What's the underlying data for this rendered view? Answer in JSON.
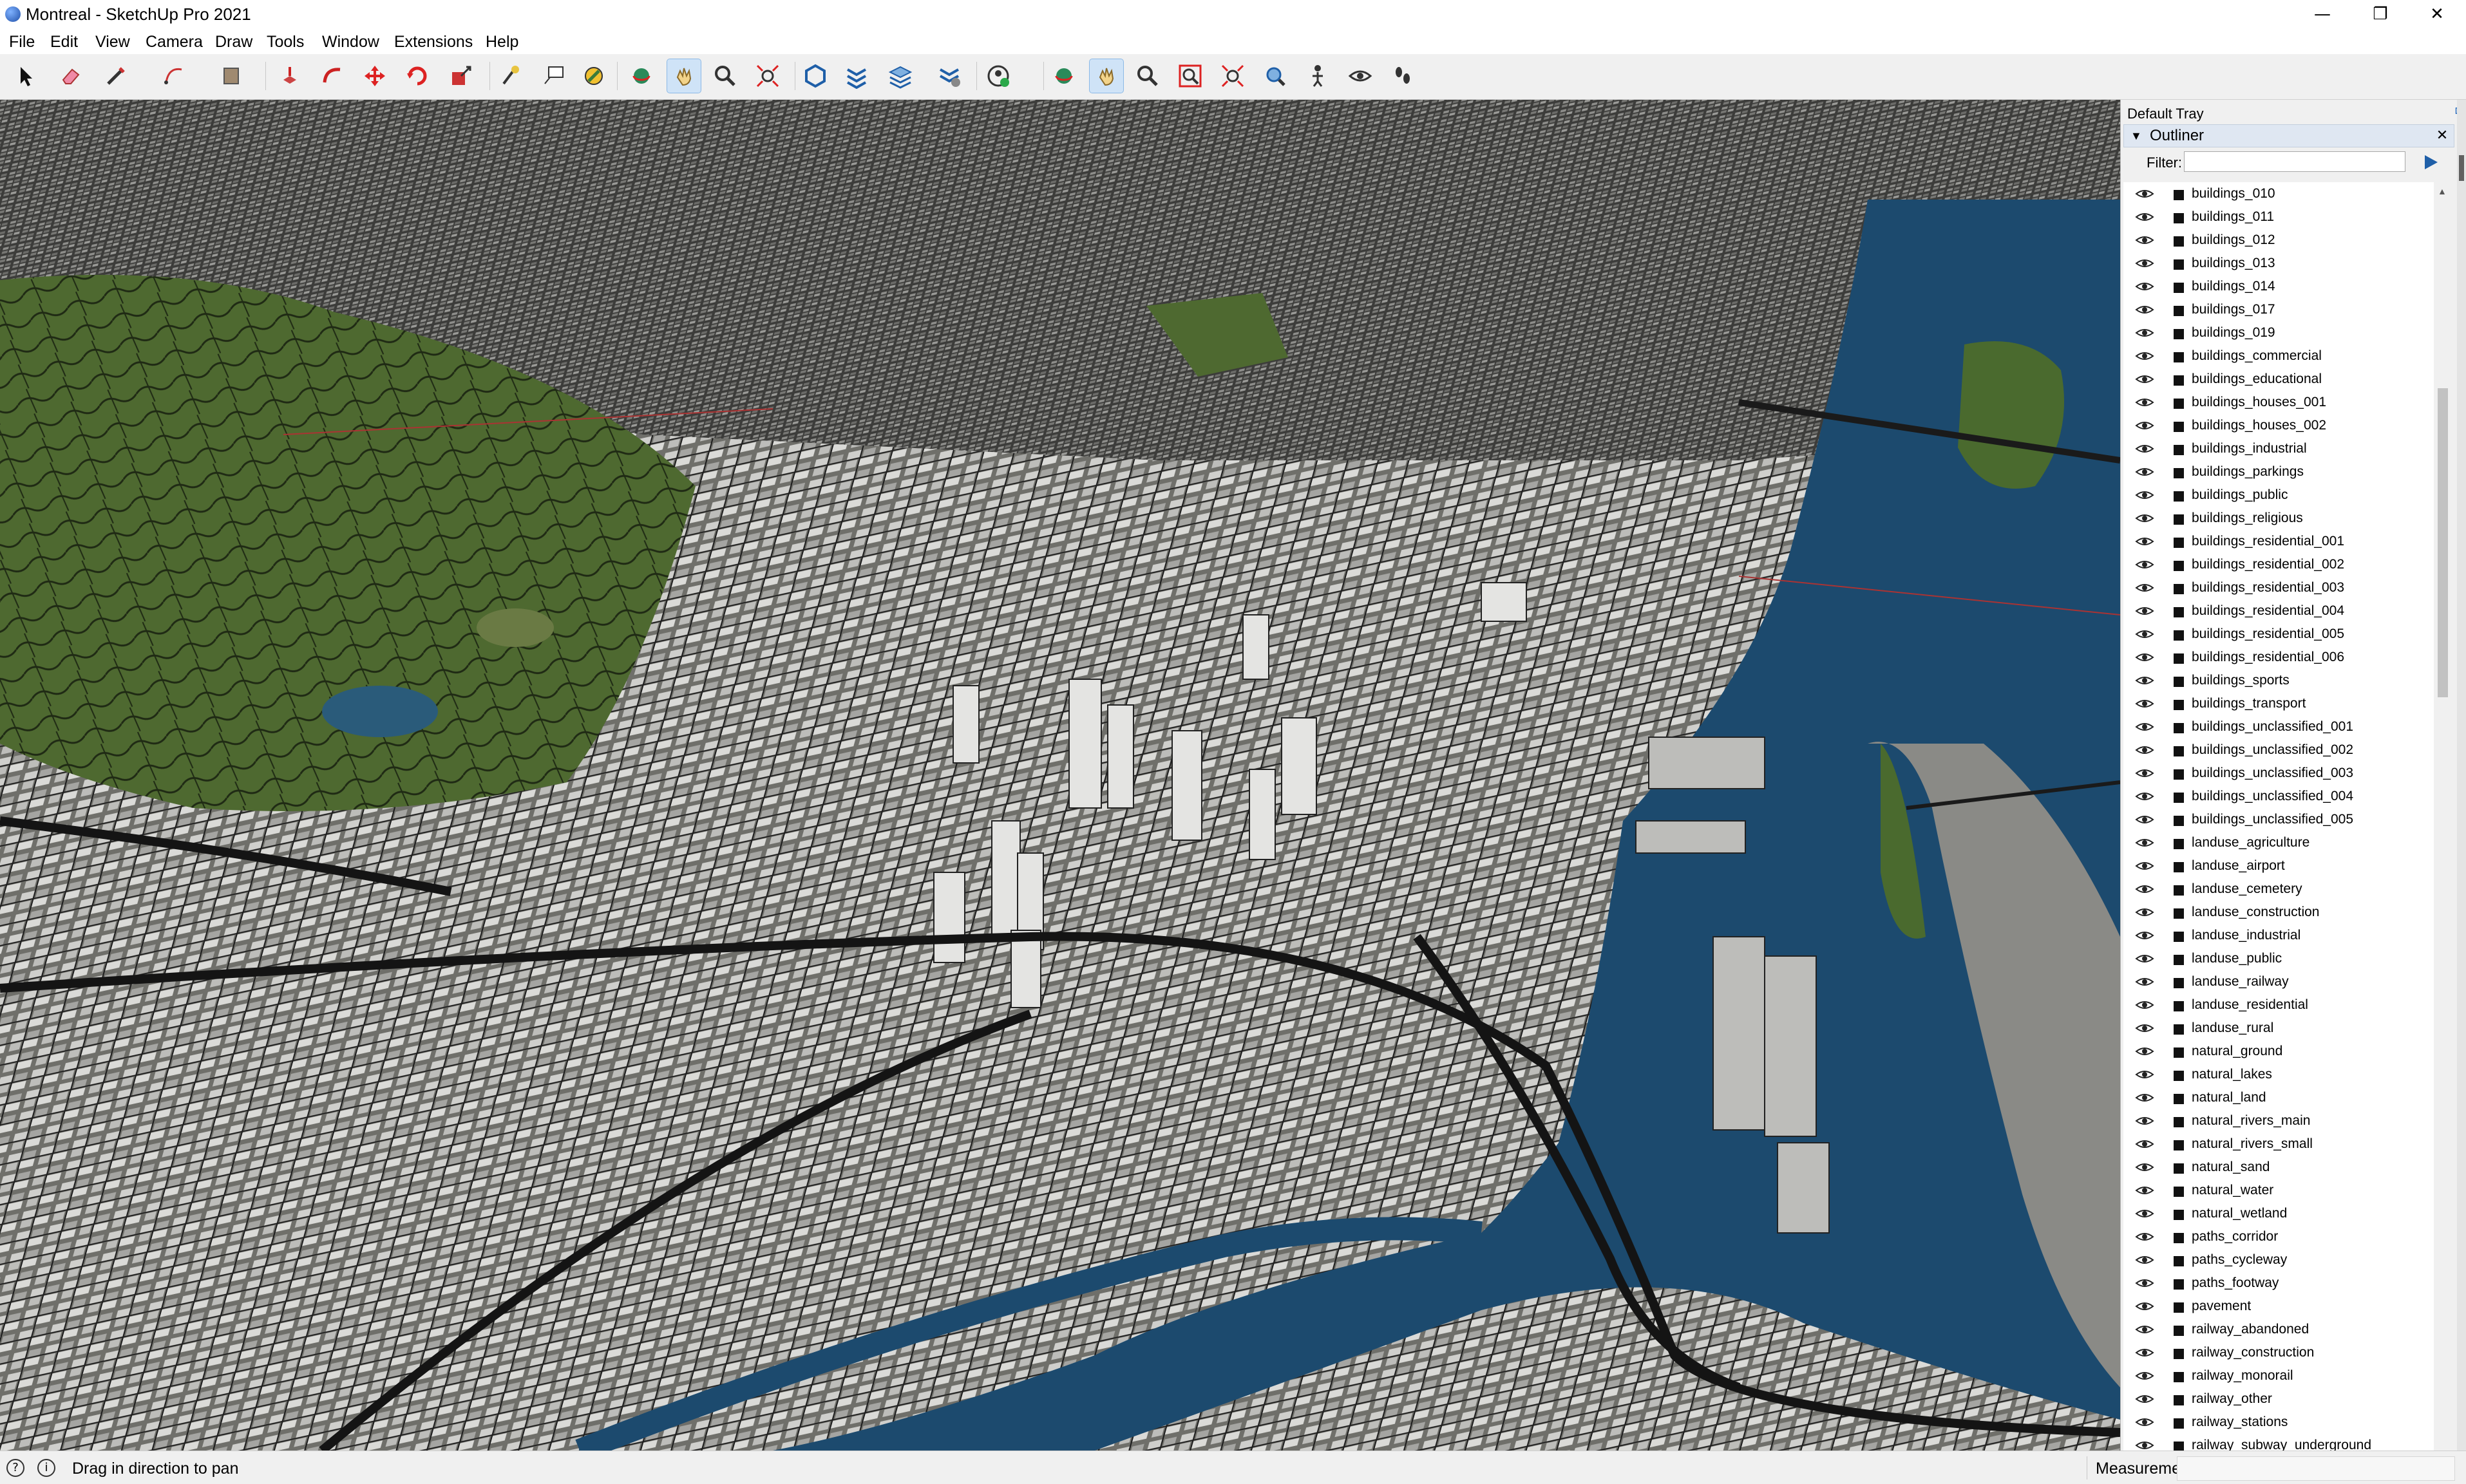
{
  "window": {
    "title": "Montreal - SketchUp Pro 2021",
    "minimize_glyph": "—",
    "maximize_glyph": "❐",
    "close_glyph": "✕"
  },
  "menu": [
    "File",
    "Edit",
    "View",
    "Camera",
    "Draw",
    "Tools",
    "Window",
    "Extensions",
    "Help"
  ],
  "toolbar": {
    "tools": [
      "select",
      "eraser",
      "line",
      "arc",
      "shape",
      "push-pull",
      "follow-me",
      "move",
      "rotate",
      "scale",
      "tape-measure",
      "text",
      "paint-bucket",
      "orbit",
      "pan",
      "zoom",
      "zoom-extents",
      "3d-warehouse",
      "extension-warehouse",
      "layout",
      "extension-manager",
      "user-account",
      "orbit",
      "pan",
      "zoom",
      "zoom-window",
      "zoom-extents",
      "zoom-previous",
      "position-camera",
      "look-around",
      "walk"
    ],
    "active": [
      "pan",
      "pan"
    ]
  },
  "tray": {
    "title": "Default Tray",
    "pin_glyph": "⊏",
    "panel_title": "Outliner",
    "panel_arrow": "▼",
    "panel_close": "✕",
    "filter_label": "Filter:",
    "filter_value": "",
    "items": [
      "buildings_010",
      "buildings_011",
      "buildings_012",
      "buildings_013",
      "buildings_014",
      "buildings_017",
      "buildings_019",
      "buildings_commercial",
      "buildings_educational",
      "buildings_houses_001",
      "buildings_houses_002",
      "buildings_industrial",
      "buildings_parkings",
      "buildings_public",
      "buildings_religious",
      "buildings_residential_001",
      "buildings_residential_002",
      "buildings_residential_003",
      "buildings_residential_004",
      "buildings_residential_005",
      "buildings_residential_006",
      "buildings_sports",
      "buildings_transport",
      "buildings_unclassified_001",
      "buildings_unclassified_002",
      "buildings_unclassified_003",
      "buildings_unclassified_004",
      "buildings_unclassified_005",
      "landuse_agriculture",
      "landuse_airport",
      "landuse_cemetery",
      "landuse_construction",
      "landuse_industrial",
      "landuse_public",
      "landuse_railway",
      "landuse_residential",
      "landuse_rural",
      "natural_ground",
      "natural_lakes",
      "natural_land",
      "natural_rivers_main",
      "natural_rivers_small",
      "natural_sand",
      "natural_water",
      "natural_wetland",
      "paths_corridor",
      "paths_cycleway",
      "paths_footway",
      "pavement",
      "railway_abandoned",
      "railway_construction",
      "railway_monorail",
      "railway_other",
      "railway_stations",
      "railway_subway_underground"
    ]
  },
  "status": {
    "hint": "Drag in direction to pan",
    "icon1": "?",
    "icon2": "i",
    "measurements_label": "Measurements",
    "measurements_value": ""
  },
  "colors": {
    "water": "#1c4a6e",
    "park": "#4f6a2e",
    "ground": "#6d6d68",
    "building": "#d8d8d6",
    "road": "#1a1a1a"
  }
}
